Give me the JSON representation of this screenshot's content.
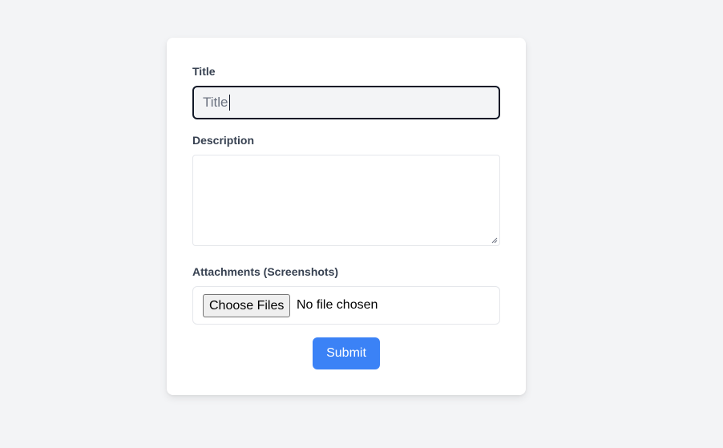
{
  "form": {
    "title_label": "Title",
    "title_value": "Title",
    "description_label": "Description",
    "description_value": "",
    "attachments_label": "Attachments (Screenshots)",
    "choose_files_label": "Choose Files",
    "file_status": "No file chosen",
    "submit_label": "Submit"
  },
  "colors": {
    "page_background": "#f3f4f6",
    "card_background": "#ffffff",
    "accent": "#3b82f6",
    "label_text": "#374151",
    "focus_border": "#111827"
  },
  "icons": {
    "resize": "resize-grip-icon"
  }
}
